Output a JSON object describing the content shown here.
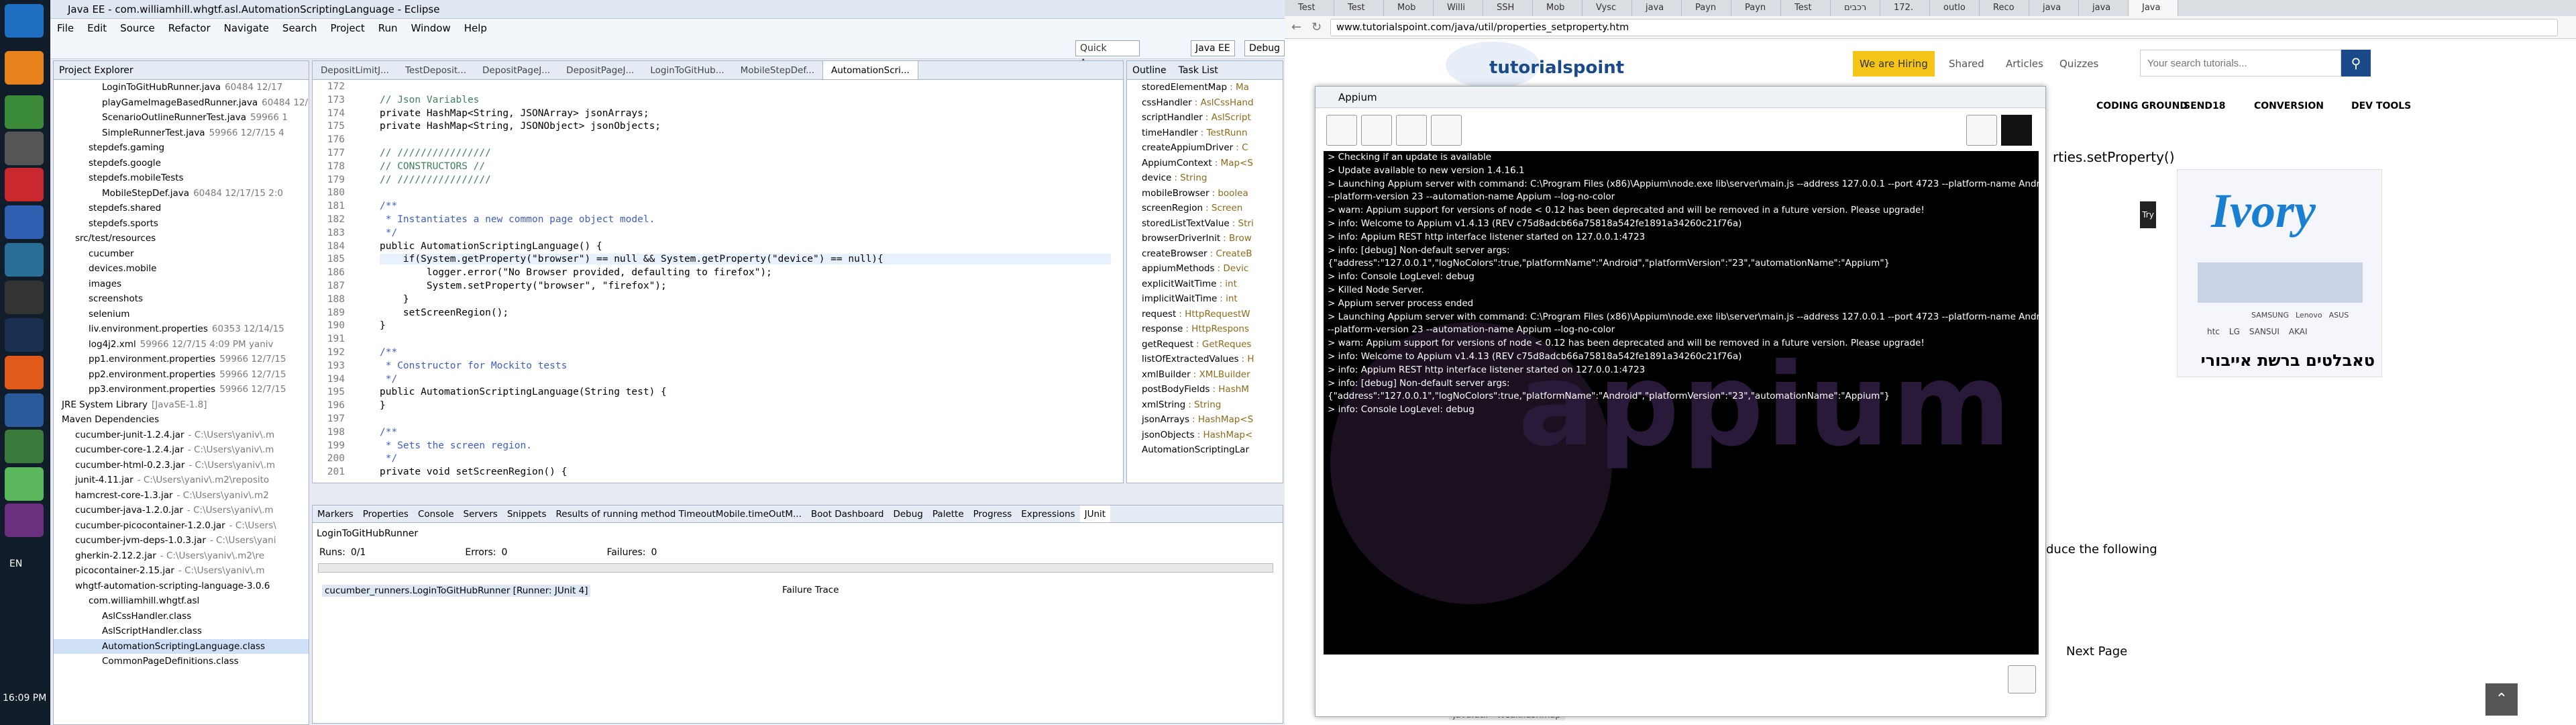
{
  "taskbar": {
    "language": "EN",
    "time": "16:09 PM"
  },
  "eclipse": {
    "title": "Java EE - com.williamhill.whgtf.asl.AutomationScriptingLanguage - Eclipse",
    "menu": [
      "File",
      "Edit",
      "Source",
      "Refactor",
      "Navigate",
      "Search",
      "Project",
      "Run",
      "Window",
      "Help"
    ],
    "quick_access": "Quick Access",
    "perspectives": [
      "Java EE",
      "Debug"
    ],
    "project_explorer": {
      "title": "Project Explorer",
      "items": [
        {
          "t": "LoginToGitHubRunner.java",
          "m": "60484 12/17"
        },
        {
          "t": "playGameImageBasedRunner.java",
          "m": "60484 12/"
        },
        {
          "t": "ScenarioOutlineRunnerTest.java",
          "m": "59966 1"
        },
        {
          "t": "SimpleRunnerTest.java",
          "m": "59966 12/7/15 4"
        },
        {
          "t": "stepdefs.gaming",
          "m": ""
        },
        {
          "t": "stepdefs.google",
          "m": ""
        },
        {
          "t": "stepdefs.mobileTests",
          "m": ""
        },
        {
          "t": "MobileStepDef.java",
          "m": "60484 12/17/15 2:0"
        },
        {
          "t": "stepdefs.shared",
          "m": ""
        },
        {
          "t": "stepdefs.sports",
          "m": ""
        },
        {
          "t": "src/test/resources",
          "m": ""
        },
        {
          "t": "cucumber",
          "m": ""
        },
        {
          "t": "devices.mobile",
          "m": ""
        },
        {
          "t": "images",
          "m": ""
        },
        {
          "t": "screenshots",
          "m": ""
        },
        {
          "t": "selenium",
          "m": ""
        },
        {
          "t": "liv.environment.properties",
          "m": "60353 12/14/15"
        },
        {
          "t": "log4j2.xml",
          "m": "59966 12/7/15 4:09 PM yaniv"
        },
        {
          "t": "pp1.environment.properties",
          "m": "59966 12/7/15"
        },
        {
          "t": "pp2.environment.properties",
          "m": "59966 12/7/15"
        },
        {
          "t": "pp3.environment.properties",
          "m": "59966 12/7/15"
        },
        {
          "t": "JRE System Library",
          "m": "[JavaSE-1.8]"
        },
        {
          "t": "Maven Dependencies",
          "m": ""
        },
        {
          "t": "cucumber-junit-1.2.4.jar",
          "m": "- C:\\Users\\yaniv\\.m"
        },
        {
          "t": "cucumber-core-1.2.4.jar",
          "m": "- C:\\Users\\yaniv\\.m"
        },
        {
          "t": "cucumber-html-0.2.3.jar",
          "m": "- C:\\Users\\yaniv\\.m"
        },
        {
          "t": "junit-4.11.jar",
          "m": "- C:\\Users\\yaniv\\.m2\\reposito"
        },
        {
          "t": "hamcrest-core-1.3.jar",
          "m": "- C:\\Users\\yaniv\\.m2"
        },
        {
          "t": "cucumber-java-1.2.0.jar",
          "m": "- C:\\Users\\yaniv\\.m"
        },
        {
          "t": "cucumber-picocontainer-1.2.0.jar",
          "m": "- C:\\Users\\"
        },
        {
          "t": "cucumber-jvm-deps-1.0.3.jar",
          "m": "- C:\\Users\\yani"
        },
        {
          "t": "gherkin-2.12.2.jar",
          "m": "- C:\\Users\\yaniv\\.m2\\re"
        },
        {
          "t": "picocontainer-2.15.jar",
          "m": "- C:\\Users\\yaniv\\.m"
        },
        {
          "t": "whgtf-automation-scripting-language-3.0.6",
          "m": ""
        },
        {
          "t": "com.williamhill.whgtf.asl",
          "m": ""
        },
        {
          "t": "AslCssHandler.class",
          "m": ""
        },
        {
          "t": "AslScriptHandler.class",
          "m": ""
        },
        {
          "t": "AutomationScriptingLanguage.class",
          "m": ""
        },
        {
          "t": "CommonPageDefinitions.class",
          "m": ""
        }
      ]
    },
    "editor_tabs": [
      "DepositLimitJ...",
      "TestDeposit...",
      "DepositPageJ...",
      "DepositPageJ...",
      "LoginToGitHub...",
      "MobileStepDef...",
      "AutomationScri..."
    ],
    "code_lines": [
      {
        "n": "172",
        "c": ""
      },
      {
        "n": "173",
        "c": "// Json Variables"
      },
      {
        "n": "174",
        "c": "private HashMap<String, JSONArray> jsonArrays;"
      },
      {
        "n": "175",
        "c": "private HashMap<String, JSONObject> jsonObjects;"
      },
      {
        "n": "176",
        "c": ""
      },
      {
        "n": "177",
        "c": "// ////////////////"
      },
      {
        "n": "178",
        "c": "// CONSTRUCTORS //"
      },
      {
        "n": "179",
        "c": "// ////////////////"
      },
      {
        "n": "180",
        "c": ""
      },
      {
        "n": "181",
        "c": "/**"
      },
      {
        "n": "182",
        "c": " * Instantiates a new common page object model."
      },
      {
        "n": "183",
        "c": " */"
      },
      {
        "n": "184",
        "c": "public AutomationScriptingLanguage() {"
      },
      {
        "n": "185",
        "c": "    if(System.getProperty(\"browser\") == null && System.getProperty(\"device\") == null){"
      },
      {
        "n": "186",
        "c": "        logger.error(\"No Browser provided, defaulting to firefox\");"
      },
      {
        "n": "187",
        "c": "        System.setProperty(\"browser\", \"firefox\");"
      },
      {
        "n": "188",
        "c": "    }"
      },
      {
        "n": "189",
        "c": "    setScreenRegion();"
      },
      {
        "n": "190",
        "c": "}"
      },
      {
        "n": "191",
        "c": ""
      },
      {
        "n": "192",
        "c": "/**"
      },
      {
        "n": "193",
        "c": " * Constructor for Mockito tests"
      },
      {
        "n": "194",
        "c": " */"
      },
      {
        "n": "195",
        "c": "public AutomationScriptingLanguage(String test) {"
      },
      {
        "n": "196",
        "c": "}"
      },
      {
        "n": "197",
        "c": ""
      },
      {
        "n": "198",
        "c": "/**"
      },
      {
        "n": "199",
        "c": " * Sets the screen region."
      },
      {
        "n": "200",
        "c": " */"
      },
      {
        "n": "201",
        "c": "private void setScreenRegion() {"
      }
    ],
    "outline_tabs": [
      "Outline",
      "Task List"
    ],
    "outline_items": [
      {
        "n": "storedElementMap",
        "t": ": Ma"
      },
      {
        "n": "cssHandler",
        "t": ": AslCssHand"
      },
      {
        "n": "scriptHandler",
        "t": ": AslScript"
      },
      {
        "n": "timeHandler",
        "t": ": TestRunn"
      },
      {
        "n": "createAppiumDriver",
        "t": ": C"
      },
      {
        "n": "AppiumContext",
        "t": ": Map<S"
      },
      {
        "n": "device",
        "t": ": String"
      },
      {
        "n": "mobileBrowser",
        "t": ": boolea"
      },
      {
        "n": "screenRegion",
        "t": ": Screen"
      },
      {
        "n": "storedListTextValue",
        "t": ": Stri"
      },
      {
        "n": "browserDriverInit",
        "t": ": Brow"
      },
      {
        "n": "createBrowser",
        "t": ": CreateB"
      },
      {
        "n": "appiumMethods",
        "t": ": Devic"
      },
      {
        "n": "explicitWaitTime",
        "t": ": int"
      },
      {
        "n": "implicitWaitTime",
        "t": ": int"
      },
      {
        "n": "request",
        "t": ": HttpRequestW"
      },
      {
        "n": "response",
        "t": ": HttpRespons"
      },
      {
        "n": "getRequest",
        "t": ": GetReques"
      },
      {
        "n": "listOfExtractedValues",
        "t": ": H"
      },
      {
        "n": "xmlBuilder",
        "t": ": XMLBuilder"
      },
      {
        "n": "postBodyFields",
        "t": ": HashM"
      },
      {
        "n": "xmlString",
        "t": ": String"
      },
      {
        "n": "jsonArrays",
        "t": ": HashMap<S"
      },
      {
        "n": "jsonObjects",
        "t": ": HashMap<"
      },
      {
        "n": "AutomationScriptingLar",
        "t": ""
      }
    ],
    "bottom_tabs": [
      "Markers",
      "Properties",
      "Console",
      "Servers",
      "Snippets",
      "Results of running method TimeoutMobile.timeOutM...",
      "Boot Dashboard",
      "Debug",
      "Palette",
      "Progress",
      "Expressions",
      "JUnit"
    ],
    "junit": {
      "runner_title": "LoginToGitHubRunner",
      "runs_label": "Runs:",
      "runs": "0/1",
      "errors_label": "Errors:",
      "errors": "0",
      "failures_label": "Failures:",
      "failures": "0",
      "test_item": "cucumber_runners.LoginToGitHubRunner [Runner: JUnit 4]",
      "failure_trace": "Failure Trace"
    }
  },
  "browser": {
    "tabs": [
      "Test",
      "Test",
      "Mob",
      "Willi",
      "SSH",
      "Mob",
      "Vysc",
      "java",
      "Payn",
      "Payn",
      "Test",
      "רכבים",
      "172.",
      "outlo",
      "Reco",
      "java",
      "java",
      "Java"
    ],
    "url": "www.tutorialspoint.com/java/util/properties_setproperty.htm",
    "site": {
      "logo": "tutorialspoint",
      "hiring": "We are Hiring",
      "shared": "Shared",
      "articles": "Articles",
      "quizzes": "Quizzes",
      "search_placeholder": "Your search tutorials...",
      "nav": [
        "CODING GROUND",
        "SEND18",
        "CONVERSION",
        "DEV TOOLS"
      ],
      "heading_tail": "rties.setProperty()",
      "try_it": "Try it",
      "ad_brand": "Ivory",
      "ad_hebrew": "טאבלטים ברשת אייבורי",
      "ad_brands": [
        "htc",
        "LG",
        "SANSUI",
        "AKAI",
        "SAMSUNG",
        "Lenovo",
        "ASUS"
      ],
      "body_tail": "duce the following",
      "next_page": "Next Page",
      "status_bar": "java.util - Weakhashmap"
    }
  },
  "appium": {
    "title": "Appium",
    "watermark": "appium",
    "log": [
      "> Checking if an update is available",
      "> Update available to new version 1.4.16.1",
      "> Launching Appium server with command: C:\\Program Files (x86)\\Appium\\node.exe lib\\server\\main.js --address 127.0.0.1 --port 4723 --platform-name Android",
      "--platform-version 23 --automation-name Appium --log-no-color",
      "> warn: Appium support for versions of node < 0.12 has been deprecated and will be removed in a future version. Please upgrade!",
      "> info: Welcome to Appium v1.4.13 (REV c75d8adcb66a75818a542fe1891a34260c21f76a)",
      "> info: Appium REST http interface listener started on 127.0.0.1:4723",
      "> info: [debug] Non-default server args:",
      "{\"address\":\"127.0.0.1\",\"logNoColors\":true,\"platformName\":\"Android\",\"platformVersion\":\"23\",\"automationName\":\"Appium\"}",
      "> info: Console LogLevel: debug",
      "> Killed Node Server.",
      "> Appium server process ended",
      "> Launching Appium server with command: C:\\Program Files (x86)\\Appium\\node.exe lib\\server\\main.js --address 127.0.0.1 --port 4723 --platform-name Android",
      "--platform-version 23 --automation-name Appium --log-no-color",
      "> warn: Appium support for versions of node < 0.12 has been deprecated and will be removed in a future version. Please upgrade!",
      "> info: Welcome to Appium v1.4.13 (REV c75d8adcb66a75818a542fe1891a34260c21f76a)",
      "> info: Appium REST http interface listener started on 127.0.0.1:4723",
      "> info: [debug] Non-default server args:",
      "{\"address\":\"127.0.0.1\",\"logNoColors\":true,\"platformName\":\"Android\",\"platformVersion\":\"23\",\"automationName\":\"Appium\"}",
      "> info: Console LogLevel: debug"
    ]
  },
  "colors": {
    "taskbar": "#111d2b",
    "eclipse_bg": "#e8ecf2",
    "appium_purple": "#5a2d6e",
    "tp_blue": "#1a4a8a",
    "hiring_yellow": "#f5c518"
  }
}
